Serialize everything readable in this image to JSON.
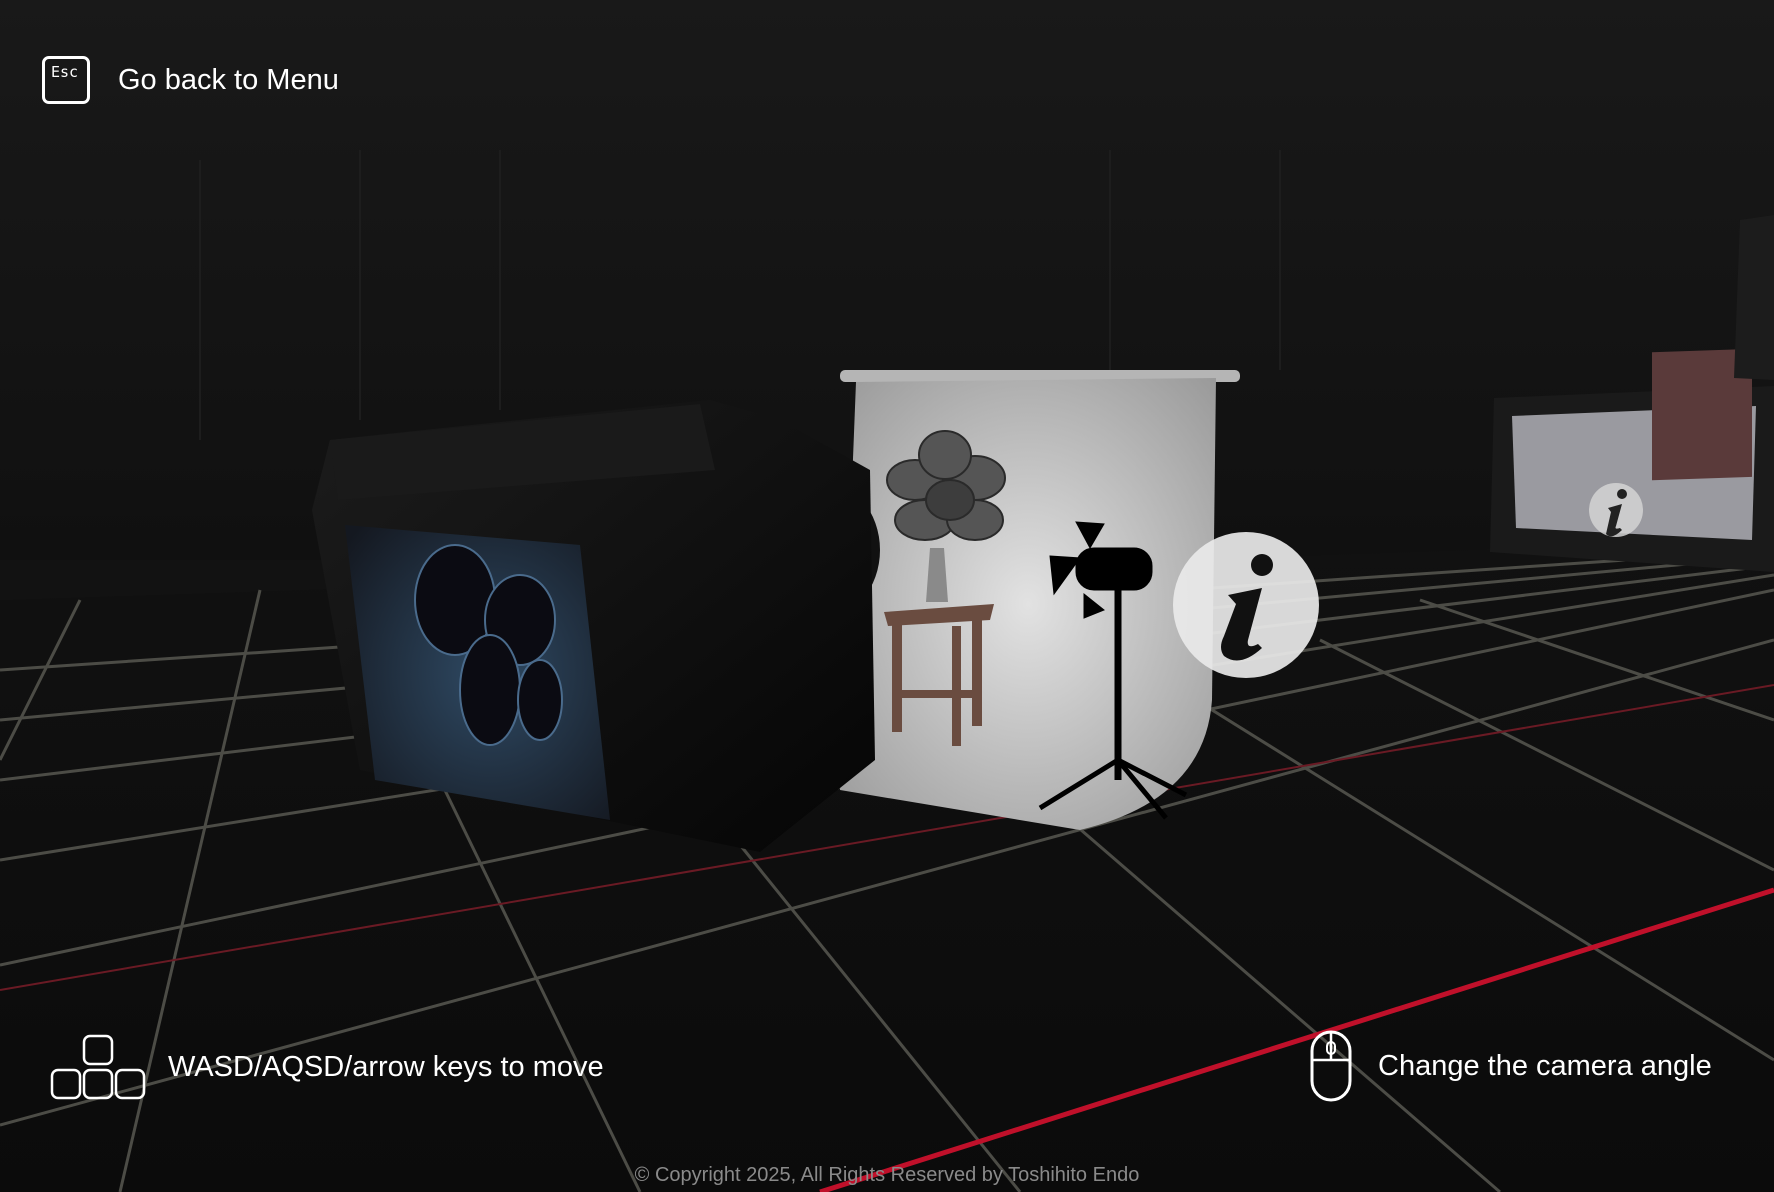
{
  "hud": {
    "esc_key": "Esc",
    "back_label": "Go back to Menu",
    "move_label": "WASD/AQSD/arrow keys to move",
    "camera_label": "Change the camera angle"
  },
  "footer": {
    "copyright": "© Copyright 2025, All Rights Reserved by Toshihito Endo"
  },
  "icons": {
    "escape": "keyboard-esc-icon",
    "keys": "keyboard-keys-icon",
    "mouse": "mouse-icon",
    "info": "info-icon"
  },
  "colors": {
    "background": "#121212",
    "floor": "#0d0d0d",
    "grid": "#55554f",
    "accent_line": "#c0102a",
    "text": "#ffffff",
    "muted_text": "#8a8a8a"
  }
}
